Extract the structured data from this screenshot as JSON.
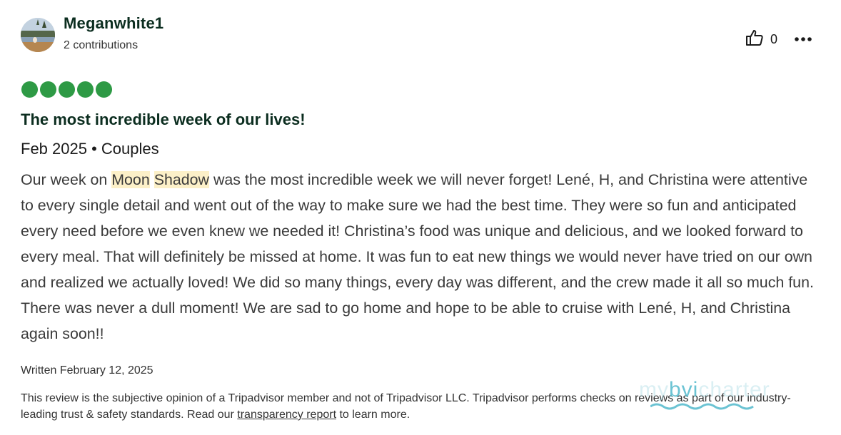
{
  "review": {
    "username": "Meganwhite1",
    "contributions": "2 contributions",
    "helpful_count": "0",
    "rating": 5,
    "rating_max": 5,
    "title": "The most incredible week of our lives!",
    "trip_meta": "Feb 2025 • Couples",
    "body_before": "Our week on ",
    "body_hl1": "Moon",
    "body_space": " ",
    "body_hl2": "Shadow",
    "body_after": " was the most incredible week we will never forget! Lené, H, and Christina were attentive to every single detail and went out of the way to make sure we had the best time. They were so fun and anticipated every need before we even knew we needed it! Christina’s food was unique and delicious, and we looked forward to every meal. That will definitely be missed at home. It was fun to eat new things we would never have tried on our own and realized we actually loved! We did so many things, every day was different, and the crew made it all so much fun. There was never a dull moment! We are sad to go home and hope to be able to cruise with Lené, H, and Christina again soon!!",
    "written": "Written February 12, 2025",
    "disclaimer_before": "This review is the subjective opinion of a Tripadvisor member and not of Tripadvisor LLC. Tripadvisor performs checks on reviews as part of our industry-leading trust & safety standards. Read our ",
    "disclaimer_link": "transparency report",
    "disclaimer_after": " to learn more."
  },
  "icons": {
    "helpful": "thumbs-up-icon",
    "more": "more-horizontal-icon"
  },
  "colors": {
    "bubble": "#2e9a45",
    "heading": "#0b2d1f",
    "highlight": "#fcf0c8"
  },
  "watermark": {
    "prefix": "my",
    "brand": "bvi",
    "suffix": "charter"
  }
}
